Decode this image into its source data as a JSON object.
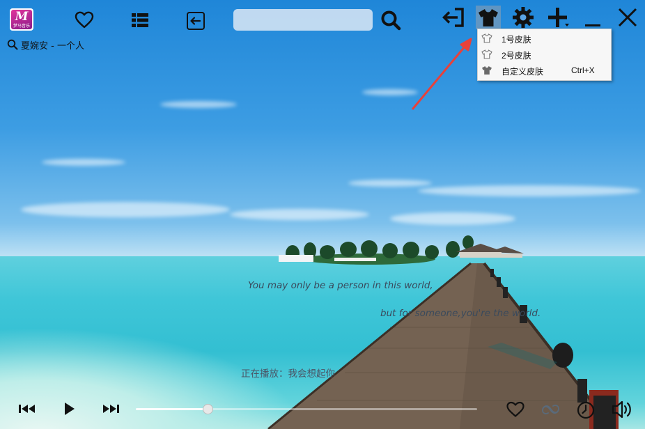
{
  "app": {
    "logo_icon": "app-logo-icon",
    "logo_letter": "M",
    "logo_caption": "梦马音乐"
  },
  "toolbar": {
    "icons": [
      "heart-icon",
      "list-icon",
      "back-arrow-icon",
      "search-icon",
      "exit-icon",
      "shirt-icon",
      "gear-icon",
      "plus-icon",
      "minimize-icon",
      "close-icon"
    ],
    "search": {
      "value": "",
      "placeholder": ""
    }
  },
  "now_title": {
    "icon": "search-icon",
    "text": "夏婉安 - 一个人"
  },
  "skin_menu": {
    "items": [
      {
        "label": "1号皮肤",
        "shortcut": "",
        "icon": "shirt-outline-icon"
      },
      {
        "label": "2号皮肤",
        "shortcut": "",
        "icon": "shirt-outline-icon"
      },
      {
        "label": "自定义皮肤",
        "shortcut": "Ctrl+X",
        "icon": "shirt-filled-icon"
      }
    ]
  },
  "lyrics": {
    "line1": "You may only be a person in this world,",
    "line2": "but for someone,you're the world.",
    "now_playing": "正在播放：我会想起你"
  },
  "player": {
    "progress": 0.21,
    "icons": [
      "previous-icon",
      "play-icon",
      "next-icon",
      "like-icon",
      "loop-icon",
      "timer-icon",
      "volume-icon"
    ]
  },
  "colors": {
    "annotation_arrow": "#e8413a",
    "menu_background": "#f7f7f7",
    "icon": "#111111"
  }
}
